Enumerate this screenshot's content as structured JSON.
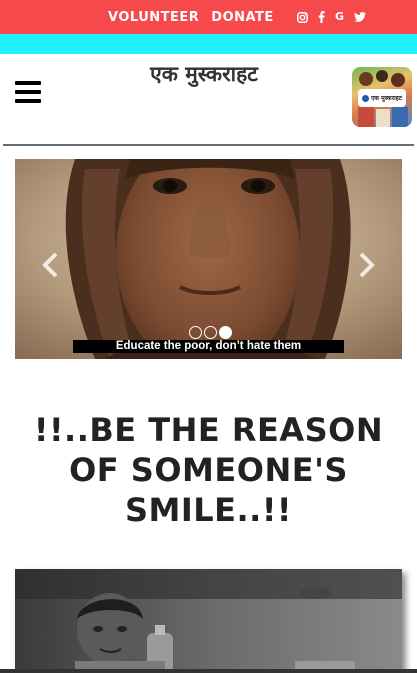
{
  "topbar": {
    "links": [
      "VOLUNTEER",
      "DONATE"
    ],
    "social_icons": [
      "instagram-icon",
      "facebook-icon",
      "google-icon",
      "twitter-icon"
    ],
    "social_glyphs": [
      "G"
    ],
    "bg_color": "#f5494c",
    "stripe_color": "#20f0ff"
  },
  "header": {
    "brand": "एक मुस्कराहट",
    "logo_text": "एक मुस्कराहट",
    "menu_icon": "hamburger-menu-icon"
  },
  "carousel": {
    "caption": "Educate the poor, don’t hate them",
    "slides": 3,
    "active_slide": 3,
    "prev_icon": "chevron-left-icon",
    "next_icon": "chevron-right-icon"
  },
  "main": {
    "tagline": "!!..BE THE REASON OF SOMEONE'S SMILE..!!"
  }
}
